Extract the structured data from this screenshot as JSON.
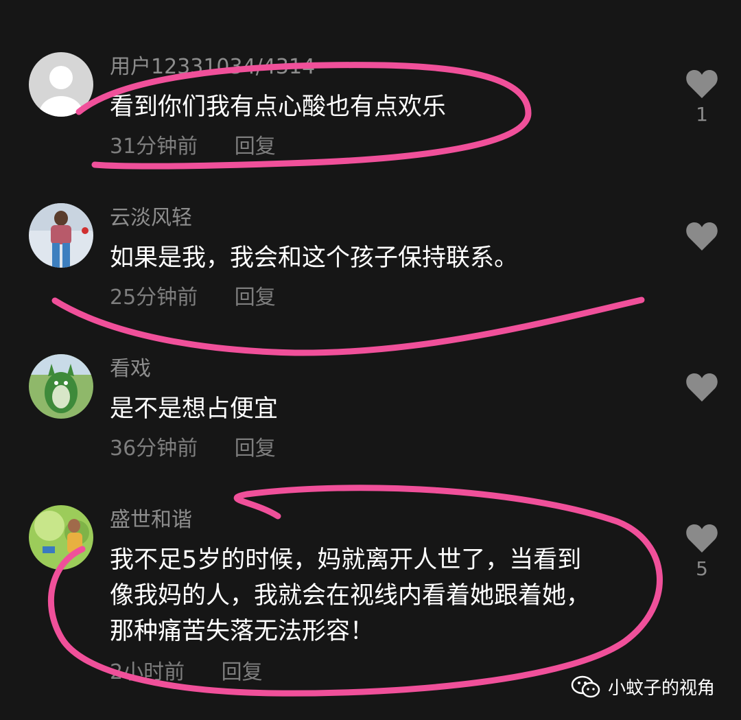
{
  "comments": [
    {
      "username": "用户12331034/4314",
      "text": "看到你们我有点心酸也有点欢乐",
      "time": "31分钟前",
      "reply": "回复",
      "likes": "1"
    },
    {
      "username": "云淡风轻",
      "text": "如果是我，我会和这个孩子保持联系。",
      "time": "25分钟前",
      "reply": "回复",
      "likes": ""
    },
    {
      "username": "看戏",
      "text": "是不是想占便宜",
      "time": "36分钟前",
      "reply": "回复",
      "likes": ""
    },
    {
      "username": "盛世和谐",
      "text_lines": [
        "我不足5岁的时候，妈就离开人世了，当看到",
        "像我妈的人，我就会在视线内看着她跟着她，",
        "那种痛苦失落无法形容！"
      ],
      "time": "2小时前",
      "reply": "回复",
      "likes": "5"
    }
  ],
  "watermark": {
    "label": "小蚊子的视角",
    "icon": "wechat-icon"
  },
  "colors": {
    "background": "#161616",
    "annotation": "#f0509a",
    "username": "#8d8d8d",
    "meta": "#7e7e7e",
    "like_icon": "#8a8a8a"
  }
}
